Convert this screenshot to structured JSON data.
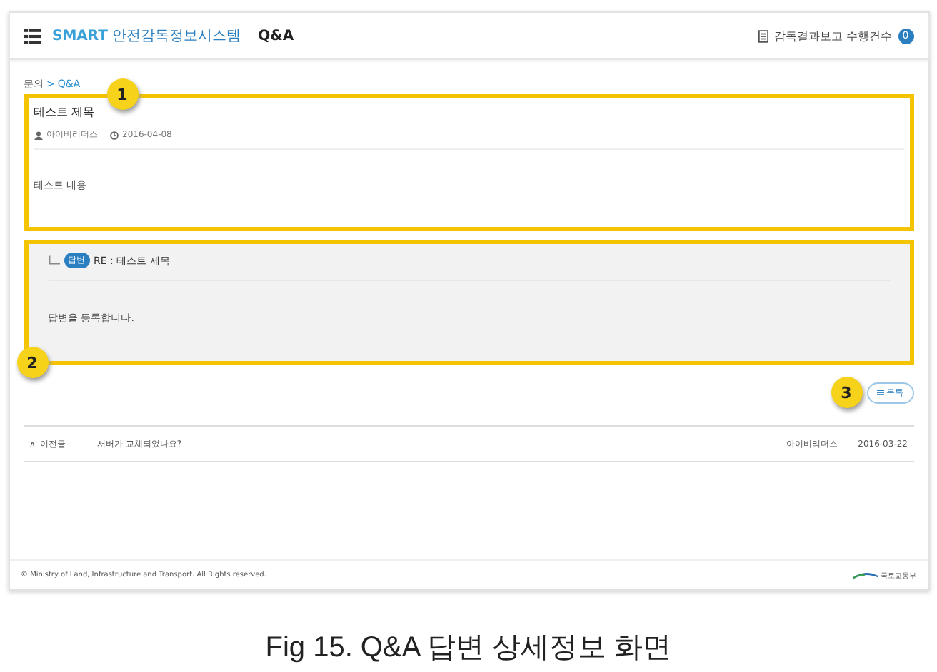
{
  "header": {
    "logo_brand": "SMART",
    "logo_text": "안전감독정보시스템",
    "title": "Q&A",
    "report_link": "감독결과보고 수행건수",
    "report_count": "0"
  },
  "breadcrumb": {
    "home": "문의",
    "separator": ">",
    "current": "Q&A"
  },
  "question": {
    "title": "테스트 제목",
    "author": "아이비리더스",
    "date": "2016-04-08",
    "body": "테스트 내용"
  },
  "answer": {
    "tag": "답변",
    "title": "RE : 테스트 제목",
    "body": "답변을 등록합니다."
  },
  "list_button": "목록",
  "prev_post": {
    "arrow": "∧",
    "label": "이전글",
    "title": "서버가 교체되었나요?",
    "author": "아이비리더스",
    "date": "2016-03-22"
  },
  "footer": {
    "copyright": "© Ministry of Land, Infrastructure and Transport. All Rights reserved.",
    "ministry": "국토교통부"
  },
  "callouts": [
    "1",
    "2",
    "3"
  ],
  "caption": "Fig 15. Q&A 답변 상세정보 화면"
}
